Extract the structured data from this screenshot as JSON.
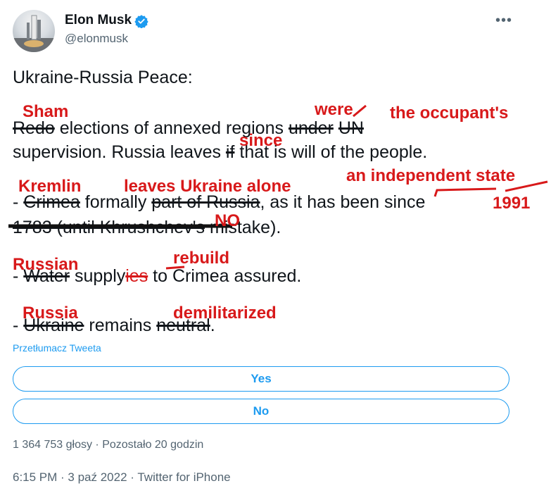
{
  "header": {
    "display_name": "Elon Musk",
    "handle": "@elonmusk",
    "more_glyph": "•••",
    "verified_icon": "verified-badge-icon",
    "accent_color": "#1d9bf0"
  },
  "tweet": {
    "title": "Ukraine-Russia Peace:",
    "line1": {
      "struck_redo": " Redo",
      "text_a": " elections of annexed regions ",
      "struck_under": "under",
      "space": " ",
      "struck_un": "UN"
    },
    "line2": {
      "text_a": "supervision. Russia leaves ",
      "struck_if": "if",
      "text_b": " that is will of the people."
    },
    "line3": {
      "dash": "- ",
      "struck_crimea": "Crimea",
      "text_a": " formally ",
      "struck_part": "part of Russia",
      "text_b": ", as it has been since"
    },
    "line4": {
      "struck_1783": "1783 (until Khrushchev's",
      "text_a": " mistake)."
    },
    "line5": {
      "dash": "- ",
      "struck_water": "Water",
      "text_a": " supply",
      "struck_ies": "ies",
      "text_b": " to Crimea assured."
    },
    "line6": {
      "dash": "- ",
      "struck_ukraine": "Ukraine",
      "text_a": " remains ",
      "struck_neutral": "neutral",
      "text_b": "."
    }
  },
  "annotations": {
    "sham": "Sham",
    "were": "were",
    "occupant": "the occupant's",
    "since": "since",
    "independent": "an independent state",
    "kremlin": "Kremlin",
    "leaves_alone": "leaves Ukraine alone",
    "year_1991": "1991",
    "no": "NO",
    "russian": "Russian",
    "rebuild": "rebuild",
    "russia": "Russia",
    "demilitarized": "demilitarized",
    "ink_color": "#d8191a"
  },
  "translate_link": "Przetłumacz Tweeta",
  "poll": {
    "options": [
      "Yes",
      "No"
    ],
    "meta": "1 364 753 głosy · Pozostało 20 godzin"
  },
  "footer": {
    "timestamp": "6:15 PM · 3 paź 2022 · Twitter for iPhone"
  }
}
